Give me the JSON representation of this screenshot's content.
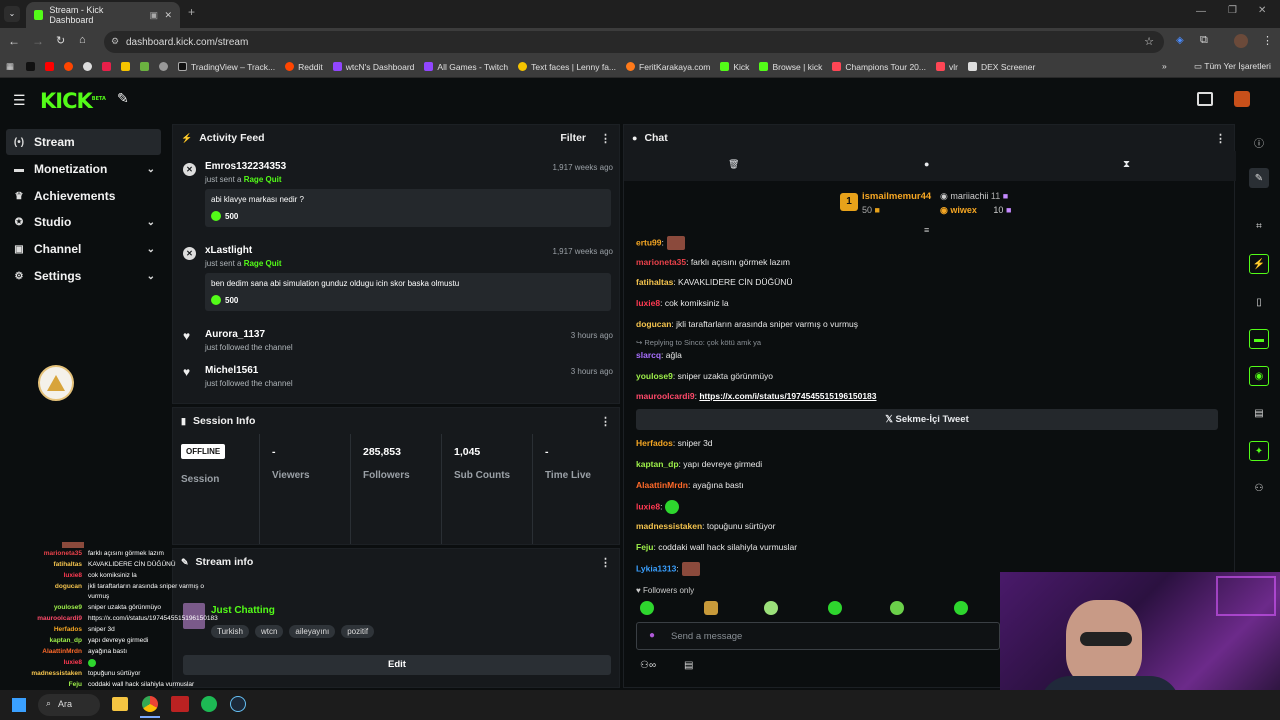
{
  "browser": {
    "tab_title": "Stream - Kick Dashboard",
    "url": "dashboard.kick.com/stream",
    "bookmarks": [
      "TradingView – Track...",
      "Reddit",
      "wtcN's Dashboard",
      "All Games - Twitch",
      "Text faces | Lenny fa...",
      "FeritKarakaya.com",
      "Kick",
      "Browse | kick",
      "Champions Tour 20...",
      "vlr",
      "DEX Screener"
    ],
    "all_bookmarks": "Tüm Yer İşaretleri"
  },
  "brand": {
    "logo": "KICK",
    "beta": "BETA",
    "accent": "#53fc18"
  },
  "sidebar": {
    "items": [
      {
        "label": "Stream",
        "icon": "broadcast-icon"
      },
      {
        "label": "Monetization",
        "icon": "money-icon"
      },
      {
        "label": "Achievements",
        "icon": "trophy-icon"
      },
      {
        "label": "Studio",
        "icon": "studio-icon"
      },
      {
        "label": "Channel",
        "icon": "profile-icon"
      },
      {
        "label": "Settings",
        "icon": "gear-icon"
      }
    ]
  },
  "activity": {
    "title": "Activity Feed",
    "filter": "Filter",
    "items": [
      {
        "name": "Emros132234353",
        "sub_pre": "just sent a",
        "sub_hl": "Rage Quit",
        "time": "1,917 weeks ago",
        "msg": "abi klavye markası nedir ?",
        "amount": "500"
      },
      {
        "name": "xLastlight",
        "sub_pre": "just sent a",
        "sub_hl": "Rage Quit",
        "time": "1,917 weeks ago",
        "msg": "ben dedim sana abi simulation gunduz oldugu icin skor baska olmustu",
        "amount": "500"
      },
      {
        "name": "Aurora_1137",
        "sub_pre": "just followed the channel",
        "time": "3 hours ago"
      },
      {
        "name": "Michel1561",
        "sub_pre": "just followed the channel",
        "time": "3 hours ago"
      }
    ]
  },
  "session": {
    "title": "Session Info",
    "status": "OFFLINE",
    "cells": [
      {
        "value": "",
        "label": "Session"
      },
      {
        "value": "-",
        "label": "Viewers"
      },
      {
        "value": "285,853",
        "label": "Followers"
      },
      {
        "value": "1,045",
        "label": "Sub Counts"
      },
      {
        "value": "-",
        "label": "Time Live"
      }
    ]
  },
  "stream_info": {
    "title": "Stream info",
    "category": "Just Chatting",
    "tags": [
      "Turkish",
      "wtcn",
      "aileyayını",
      "pozitif"
    ],
    "edit": "Edit"
  },
  "chat": {
    "title": "Chat",
    "leaders": [
      {
        "rank": "1",
        "name": "ismailmemur44",
        "score": "50"
      },
      {
        "name": "mariiachii",
        "score": "11"
      },
      {
        "name": "wiwex",
        "score": "10"
      }
    ],
    "messages": [
      {
        "user": "ertu99",
        "color": "#f5a623",
        "text": ":",
        "emote": true
      },
      {
        "user": "marioneta35",
        "color": "#e8414a",
        "text": ": farklı açısını görmek lazım"
      },
      {
        "user": "fatihaltas",
        "color": "#f5c44e",
        "text": ": KAVAKLIDERE CİN DÜĞÜNÜ"
      },
      {
        "user": "luxie8",
        "color": "#ff3a52",
        "text": ": cok komiksiniz la"
      },
      {
        "user": "dogucan",
        "color": "#f5c44e",
        "text": ": jkli taraftarların arasında sniper varmış o vurmuş"
      },
      {
        "reply": "Replying to Sinco: çok kötü amk ya"
      },
      {
        "user": "slarcq",
        "color": "#a970ff",
        "text": ": ağla"
      },
      {
        "user": "youlose9",
        "color": "#9ef04a",
        "text": ": sniper uzakta görünmüyo"
      },
      {
        "user": "mauroolcardi9",
        "color": "#ff4a6a",
        "link": "https://x.com/i/status/1974545515196150183"
      },
      {
        "embed": "Sekme-İçi Tweet"
      },
      {
        "user": "Herfados",
        "color": "#f5a623",
        "text": ": sniper 3d"
      },
      {
        "user": "kaptan_dp",
        "color": "#9ef04a",
        "text": ": yapı devreye girmedi"
      },
      {
        "user": "AlaattinMrdn",
        "color": "#ff6a2a",
        "text": ": ayağına bastı"
      },
      {
        "user": "luxie8",
        "color": "#ff3a52",
        "text": ":",
        "gem": true
      },
      {
        "user": "madnessistaken",
        "color": "#f5c44e",
        "text": ": topuğunu sürtüyor"
      },
      {
        "user": "Feju",
        "color": "#9ef04a",
        "text": ": coddaki wall hack silahiyla vurmuslar"
      },
      {
        "user": "Lykia1313",
        "color": "#3aa0ff",
        "text": ":",
        "emote": true
      }
    ],
    "followers_only": "Followers only",
    "input_placeholder": "Send a message"
  },
  "overlay": {
    "rows": [
      {
        "n": "marioneta35",
        "c": "#e8414a",
        "t": "farklı açısını görmek lazım"
      },
      {
        "n": "fatihaltas",
        "c": "#f5c44e",
        "t": "KAVAKLIDERE CİN DÜĞÜNÜ"
      },
      {
        "n": "luxie8",
        "c": "#ff3a52",
        "t": "cok komiksiniz la"
      },
      {
        "n": "dogucan",
        "c": "#f5c44e",
        "t": "jkli taraftarların arasında sniper varmış o"
      },
      {
        "n": "",
        "c": "#ffffff",
        "t": "vurmuş"
      },
      {
        "n": "youlose9",
        "c": "#9ef04a",
        "t": "sniper uzakta görünmüyo"
      },
      {
        "n": "mauroolcardi9",
        "c": "#ff4a6a",
        "t": "https://x.com/i/status/1974545515196150183"
      },
      {
        "n": "Herfados",
        "c": "#f5a623",
        "t": "sniper 3d"
      },
      {
        "n": "kaptan_dp",
        "c": "#9ef04a",
        "t": "yapı devreye girmedi"
      },
      {
        "n": "AlaattinMrdn",
        "c": "#ff6a2a",
        "t": "ayağına bastı"
      },
      {
        "n": "luxie8",
        "c": "#ff3a52",
        "t": ""
      },
      {
        "n": "madnessistaken",
        "c": "#f5c44e",
        "t": "topuğunu sürtüyor"
      },
      {
        "n": "Feju",
        "c": "#9ef04a",
        "t": "coddaki wall hack silahiyla vurmuslar"
      }
    ]
  },
  "taskbar": {
    "search": "Ara"
  }
}
